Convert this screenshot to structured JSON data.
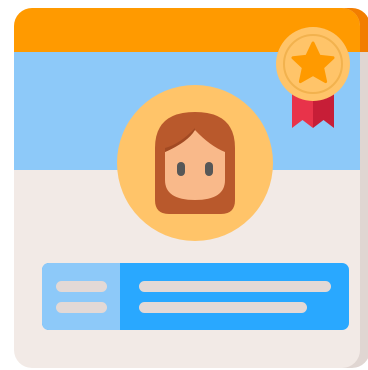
{
  "icon": {
    "name": "profile-card-award-icon",
    "description_visible": false
  },
  "colors": {
    "header": "#FF9A00",
    "header_shadow": "#F27E00",
    "banner": "#8DC9F9",
    "card_body": "#F2EAE6",
    "card_shadow": "#E0D6D2",
    "avatar_circle": "#FFC469",
    "hair": "#B9592C",
    "hair_dark": "#A24A23",
    "face": "#F9B98A",
    "eyes": "#575757",
    "info_left": "#8DC9F9",
    "info_right": "#29A8FF",
    "line_light": "#E3D9D6",
    "badge_circle": "#FFC469",
    "badge_star": "#FF9A00",
    "ribbon": "#E8334A",
    "ribbon_dark": "#C71E37"
  }
}
